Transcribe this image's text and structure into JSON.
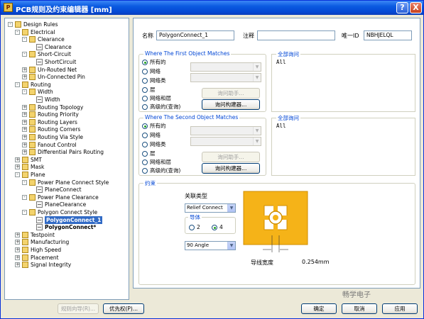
{
  "window": {
    "title": "PCB规则及约束编辑器 [mm]",
    "help_label": "?",
    "close_label": "X"
  },
  "tree": [
    {
      "label": "Design Rules",
      "level": 0,
      "toggle": "-",
      "icon": "folder-icon"
    },
    {
      "label": "Electrical",
      "level": 1,
      "toggle": "-",
      "icon": "folder-icon"
    },
    {
      "label": "Clearance",
      "level": 2,
      "toggle": "-",
      "icon": "folder-icon"
    },
    {
      "label": "Clearance",
      "level": 3,
      "toggle": "",
      "icon": "rule-icon"
    },
    {
      "label": "Short-Circuit",
      "level": 2,
      "toggle": "-",
      "icon": "folder-icon"
    },
    {
      "label": "ShortCircuit",
      "level": 3,
      "toggle": "",
      "icon": "rule-icon"
    },
    {
      "label": "Un-Routed Net",
      "level": 2,
      "toggle": "+",
      "icon": "folder-icon"
    },
    {
      "label": "Un-Connected Pin",
      "level": 2,
      "toggle": "+",
      "icon": "folder-icon"
    },
    {
      "label": "Routing",
      "level": 1,
      "toggle": "-",
      "icon": "folder-icon"
    },
    {
      "label": "Width",
      "level": 2,
      "toggle": "-",
      "icon": "folder-icon"
    },
    {
      "label": "Width",
      "level": 3,
      "toggle": "",
      "icon": "rule-icon"
    },
    {
      "label": "Routing Topology",
      "level": 2,
      "toggle": "+",
      "icon": "folder-icon"
    },
    {
      "label": "Routing Priority",
      "level": 2,
      "toggle": "+",
      "icon": "folder-icon"
    },
    {
      "label": "Routing Layers",
      "level": 2,
      "toggle": "+",
      "icon": "folder-icon"
    },
    {
      "label": "Routing Corners",
      "level": 2,
      "toggle": "+",
      "icon": "folder-icon"
    },
    {
      "label": "Routing Via Style",
      "level": 2,
      "toggle": "+",
      "icon": "folder-icon"
    },
    {
      "label": "Fanout Control",
      "level": 2,
      "toggle": "+",
      "icon": "folder-icon"
    },
    {
      "label": "Differential Pairs Routing",
      "level": 2,
      "toggle": "+",
      "icon": "folder-icon"
    },
    {
      "label": "SMT",
      "level": 1,
      "toggle": "+",
      "icon": "folder-icon"
    },
    {
      "label": "Mask",
      "level": 1,
      "toggle": "+",
      "icon": "folder-icon"
    },
    {
      "label": "Plane",
      "level": 1,
      "toggle": "-",
      "icon": "folder-icon"
    },
    {
      "label": "Power Plane Connect Style",
      "level": 2,
      "toggle": "-",
      "icon": "folder-icon"
    },
    {
      "label": "PlaneConnect",
      "level": 3,
      "toggle": "",
      "icon": "rule-icon"
    },
    {
      "label": "Power Plane Clearance",
      "level": 2,
      "toggle": "-",
      "icon": "folder-icon"
    },
    {
      "label": "PlaneClearance",
      "level": 3,
      "toggle": "",
      "icon": "rule-icon"
    },
    {
      "label": "Polygon Connect Style",
      "level": 2,
      "toggle": "-",
      "icon": "folder-icon"
    },
    {
      "label": "PolygonConnect_1",
      "level": 3,
      "toggle": "",
      "icon": "rule-icon",
      "selected": true
    },
    {
      "label": "PolygonConnect*",
      "level": 3,
      "toggle": "",
      "icon": "rule-icon",
      "bold": true
    },
    {
      "label": "Testpoint",
      "level": 1,
      "toggle": "+",
      "icon": "folder-icon"
    },
    {
      "label": "Manufacturing",
      "level": 1,
      "toggle": "+",
      "icon": "folder-icon"
    },
    {
      "label": "High Speed",
      "level": 1,
      "toggle": "+",
      "icon": "folder-icon"
    },
    {
      "label": "Placement",
      "level": 1,
      "toggle": "+",
      "icon": "folder-icon"
    },
    {
      "label": "Signal Integrity",
      "level": 1,
      "toggle": "+",
      "icon": "folder-icon"
    }
  ],
  "header": {
    "name_label": "名称",
    "name_value": "PolygonConnect_1",
    "comment_label": "注释",
    "comment_value": "",
    "uid_label": "唯一ID",
    "uid_value": "NBHJELQL"
  },
  "first_match": {
    "title": "Where The First Object Matches",
    "options": [
      "所有的",
      "网络",
      "网络类",
      "层",
      "网络和层",
      "高级的(查询)"
    ],
    "selected_index": 0,
    "helper_button": "询问助手...",
    "builder_button": "询问构建器...",
    "query_title": "全部询问",
    "query_text": "All"
  },
  "second_match": {
    "title": "Where The Second Object Matches",
    "options": [
      "所有的",
      "网络",
      "网络类",
      "层",
      "网络和层",
      "高级的(查询)"
    ],
    "selected_index": 0,
    "helper_button": "询问助手...",
    "builder_button": "询问构建器...",
    "query_title": "全部询问",
    "query_text": "All"
  },
  "constraints": {
    "title": "约束",
    "connect_type_label": "关联类型",
    "connect_type_value": "Relief Connect",
    "conductors_label": "导体",
    "conductor_options": [
      "2",
      "4"
    ],
    "conductor_selected": "4",
    "angle_value": "90 Angle",
    "width_label": "导线宽度",
    "width_value": "0.254mm",
    "pad_fill_color": "#f5b318",
    "pad_edge_color": "#cf8d00"
  },
  "footer": {
    "wizard_button": "规则向导(R)...",
    "priority_button": "优先权(P)...",
    "ok_button": "确定",
    "cancel_button": "取消",
    "apply_button": "应用"
  },
  "watermark": "畅学电子"
}
